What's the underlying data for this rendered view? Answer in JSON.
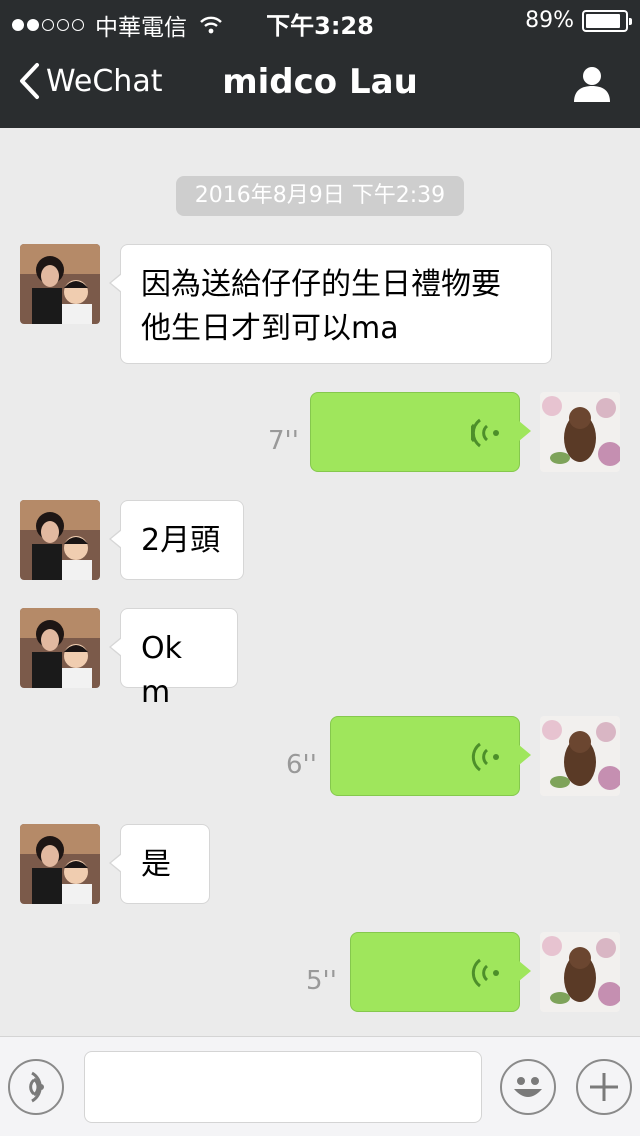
{
  "status_bar": {
    "carrier": "中華電信",
    "time": "下午3:28",
    "battery_percent_label": "89%",
    "battery_level": 0.89
  },
  "nav": {
    "back_label": "WeChat",
    "title": "midco Lau",
    "back_icon": "chevron-left-icon",
    "profile_icon": "person-icon"
  },
  "chat": {
    "timestamp": "2016年8月9日 下午2:39",
    "messages": [
      {
        "type": "text",
        "side": "left",
        "lines": [
          "因為送給仔仔的生日禮物要",
          "他生日才到可以ma"
        ]
      },
      {
        "type": "voice",
        "side": "right",
        "duration": "7''"
      },
      {
        "type": "text",
        "side": "left",
        "lines": [
          "2月頭"
        ]
      },
      {
        "type": "text",
        "side": "left",
        "lines": [
          "Ok m"
        ]
      },
      {
        "type": "voice",
        "side": "right",
        "duration": "6''"
      },
      {
        "type": "text",
        "side": "left",
        "lines": [
          "是"
        ]
      },
      {
        "type": "voice",
        "side": "right",
        "duration": "5''"
      }
    ]
  },
  "input_bar": {
    "voice_toggle_icon": "voice-mode-icon",
    "emoji_icon": "smiley-icon",
    "more_icon": "plus-icon",
    "text_value": ""
  },
  "colors": {
    "nav_bg": "#2a2d2f",
    "chat_bg": "#ebebeb",
    "voice_bubble": "#9fe65c",
    "incoming_bubble": "#ffffff"
  }
}
